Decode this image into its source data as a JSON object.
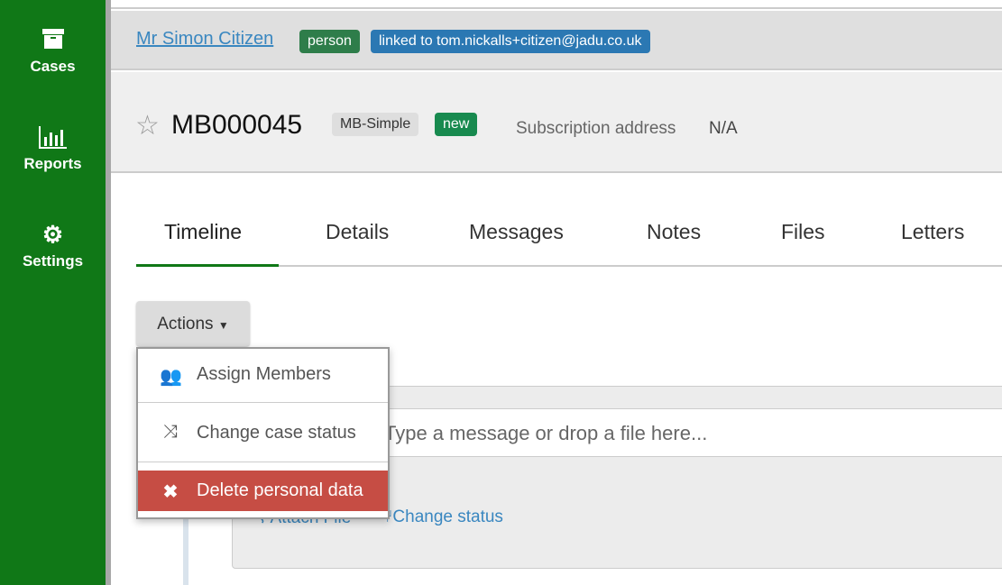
{
  "sidebar": {
    "items": [
      {
        "label": "Cases",
        "icon": "archive-box-icon"
      },
      {
        "label": "Reports",
        "icon": "bar-chart-icon"
      },
      {
        "label": "Settings",
        "icon": "gear-icon"
      }
    ]
  },
  "person": {
    "name": "Mr Simon Citizen",
    "type_badge": "person",
    "linked_badge": "linked to tom.nickalls+citizen@jadu.co.uk"
  },
  "case": {
    "reference": "MB000045",
    "type_badge": "MB-Simple",
    "status_badge": "new",
    "subscription_label": "Subscription address",
    "subscription_value": "N/A"
  },
  "tabs": [
    {
      "label": "Timeline",
      "active": true
    },
    {
      "label": "Details"
    },
    {
      "label": "Messages"
    },
    {
      "label": "Notes"
    },
    {
      "label": "Files"
    },
    {
      "label": "Letters"
    }
  ],
  "actions": {
    "label": "Actions",
    "menu": [
      {
        "label": "Assign Members",
        "icon": "users-icon"
      },
      {
        "label": "Change case status",
        "icon": "shuffle-icon"
      },
      {
        "label": "Delete personal data",
        "icon": "close-icon"
      }
    ]
  },
  "compose": {
    "placeholder": "Type a message or drop a file here...",
    "attach_label": "Attach File",
    "change_status_label": "Change status"
  },
  "colors": {
    "brand": "#107817",
    "person_badge": "#2e7d4a",
    "linked_badge": "#2b78b3",
    "new_badge": "#188a4f",
    "danger": "#c64d44",
    "link": "#3a87c0"
  }
}
